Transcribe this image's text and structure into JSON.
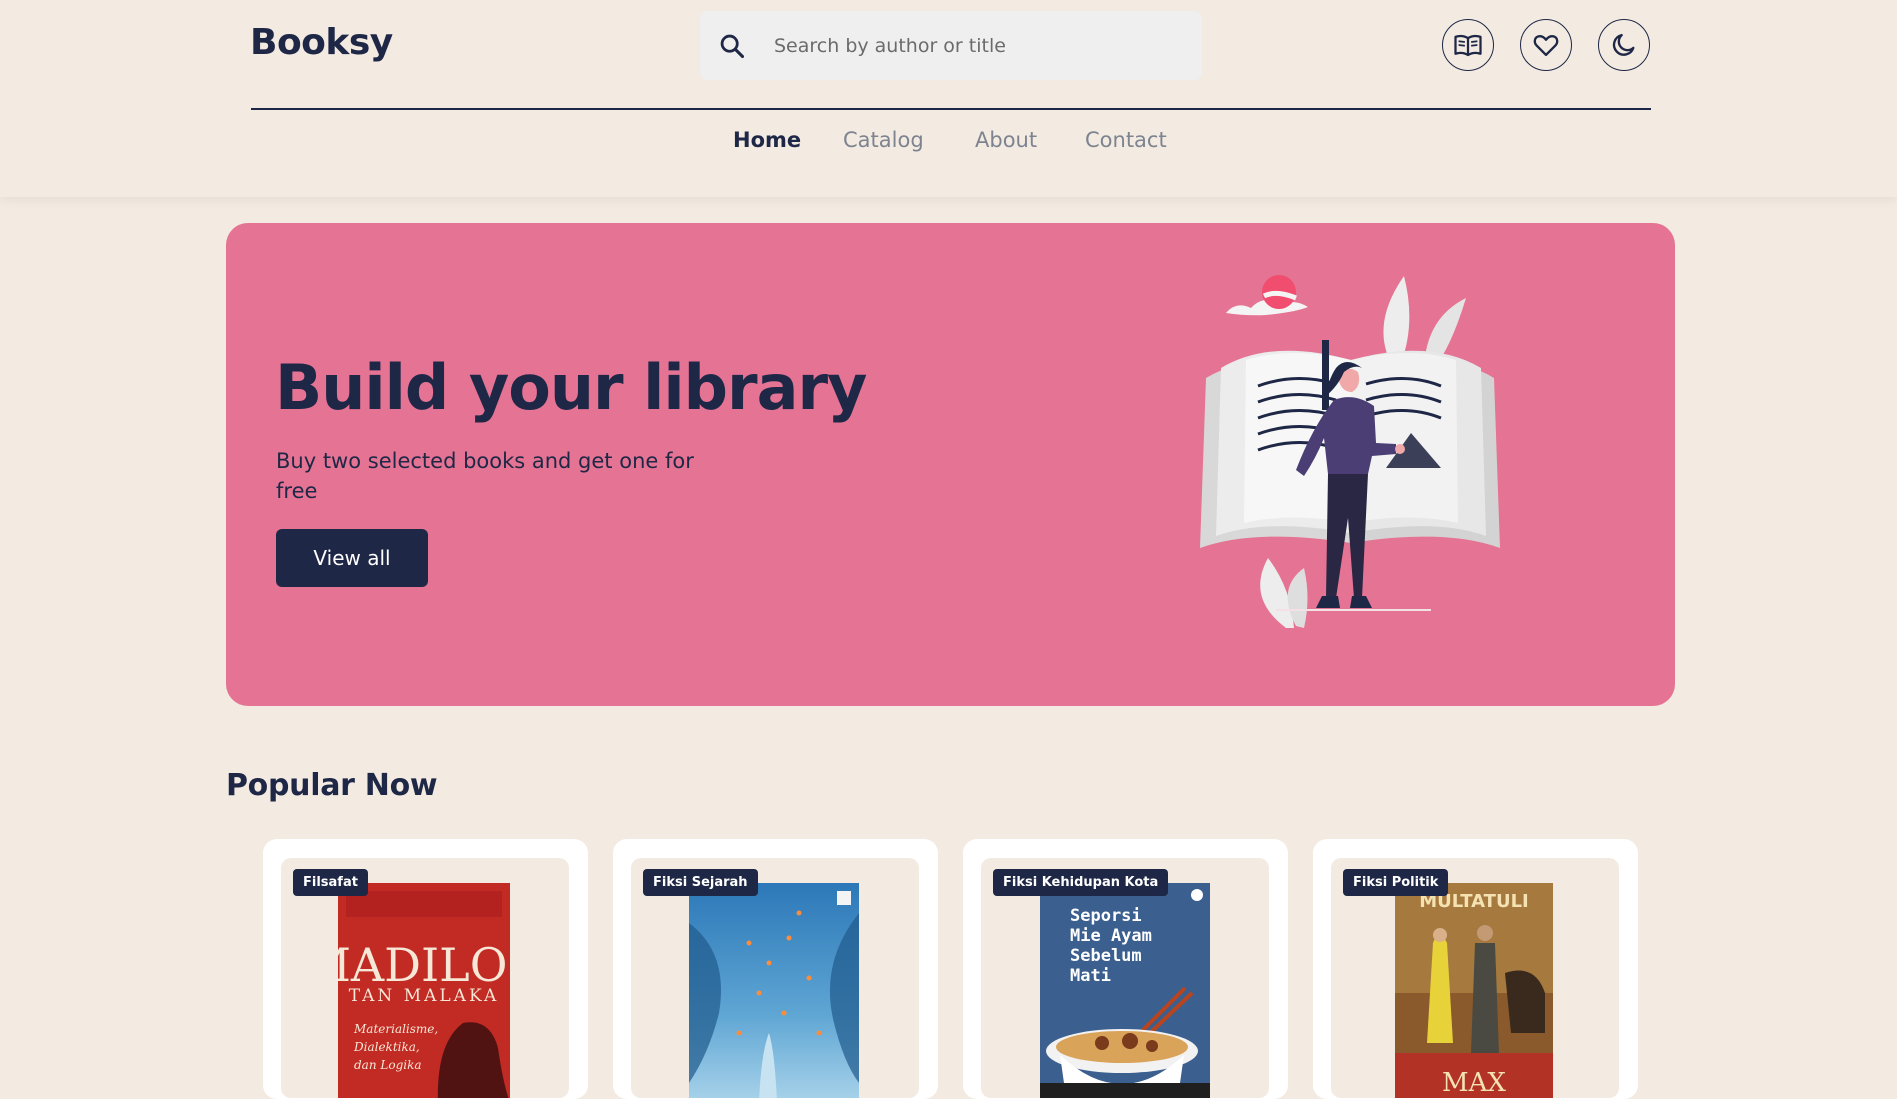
{
  "header": {
    "logo": "Booksy",
    "search_placeholder": "Search by author or title",
    "icons": [
      "book-open-icon",
      "heart-icon",
      "moon-icon"
    ]
  },
  "nav": {
    "items": [
      {
        "label": "Home",
        "active": true
      },
      {
        "label": "Catalog",
        "active": false
      },
      {
        "label": "About",
        "active": false
      },
      {
        "label": "Contact",
        "active": false
      }
    ]
  },
  "hero": {
    "title": "Build your library",
    "subtitle": "Buy two selected books and get one for free",
    "button": "View all"
  },
  "popular": {
    "title": "Popular Now",
    "books": [
      {
        "category": "Filsafat",
        "cover": {
          "title": "MADILOG",
          "author": "TAN MALAKA",
          "subtitle_lines": [
            "Materialisme,",
            "Dialektika,",
            "dan Logika"
          ]
        }
      },
      {
        "category": "Fiksi Sejarah",
        "cover": {}
      },
      {
        "category": "Fiksi Kehidupan Kota",
        "cover": {
          "title_lines": [
            "Seporsi",
            "Mie Ayam",
            "Sebelum",
            "Mati"
          ]
        }
      },
      {
        "category": "Fiksi Politik",
        "cover": {
          "author": "MULTATULI",
          "title": "MAX"
        }
      }
    ]
  },
  "colors": {
    "background": "#f3ebe2",
    "navy": "#1e2746",
    "hero": "#e57393",
    "muted_nav": "#7d8490"
  }
}
